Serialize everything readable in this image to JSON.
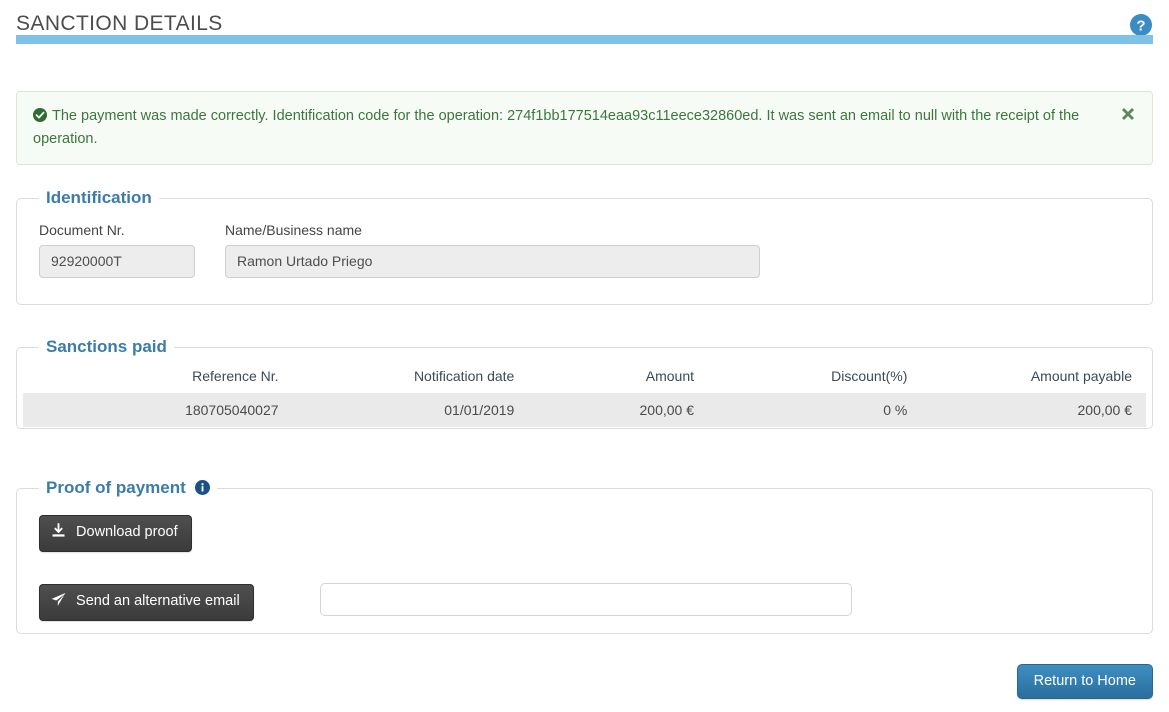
{
  "header": {
    "title": "SANCTION DETAILS",
    "help_icon": "help-circle-icon",
    "rule_color": "#7fc2e8"
  },
  "alert": {
    "status_icon": "check-circle-icon",
    "close_icon": "close-icon",
    "text": "The payment was made correctly. Identification code for the operation: 274f1bb177514eaa93c11eece32860ed. It was sent an email to null with the receipt of the operation.",
    "identification_code": "274f1bb177514eaa93c11eece32860ed",
    "email_recipient": "null",
    "text_color": "#3c763d",
    "background_color": "#f7fbf6",
    "border_color": "#d9e8d3"
  },
  "identification": {
    "legend": "Identification",
    "document_label": "Document Nr.",
    "document_value": "92920000T",
    "name_label": "Name/Business name",
    "name_value": "Ramon Urtado Priego"
  },
  "sanctions": {
    "legend": "Sanctions paid",
    "columns": [
      "Reference Nr.",
      "Notification date",
      "Amount",
      "Discount(%)",
      "Amount payable"
    ],
    "rows": [
      {
        "reference": "180705040027",
        "notification_date": "01/01/2019",
        "amount": "200,00 €",
        "discount": "0 %",
        "amount_payable": "200,00 €"
      }
    ]
  },
  "proof": {
    "legend": "Proof of payment",
    "info_icon": "info-circle-icon",
    "download_label": "Download proof",
    "download_icon": "download-icon",
    "send_label": "Send an alternative email",
    "send_icon": "paper-plane-icon",
    "email_value": "",
    "email_placeholder": ""
  },
  "footer": {
    "return_label": "Return to Home",
    "accent_color": "#2a6f9e"
  }
}
